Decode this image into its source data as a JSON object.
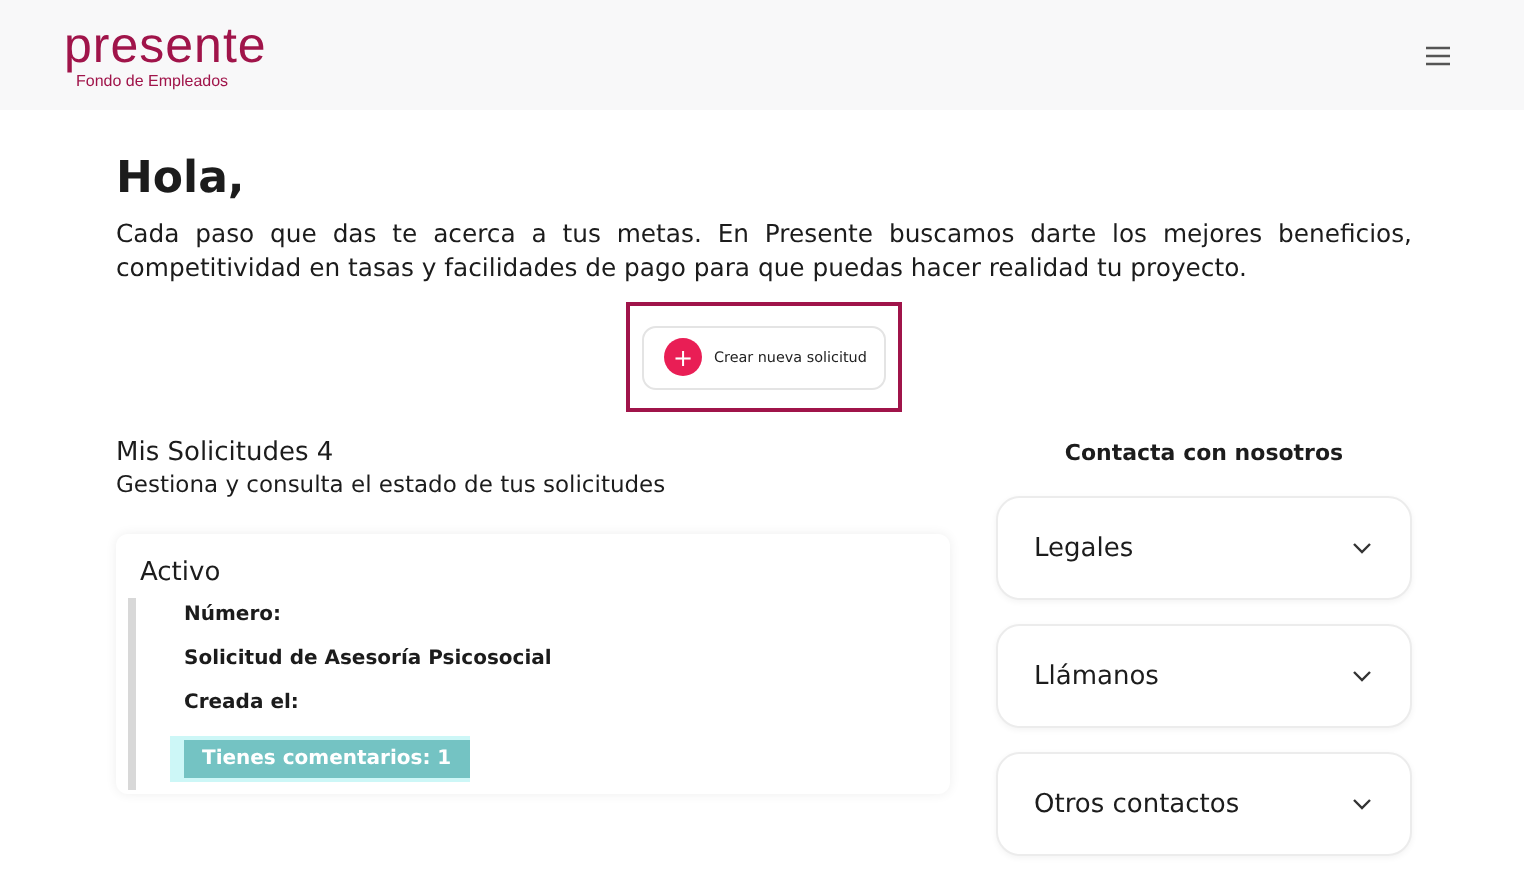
{
  "header": {
    "logo": "presente",
    "logo_subtitle": "Fondo de Empleados"
  },
  "greeting": "Hola,",
  "intro": "Cada paso que das te acerca a tus metas. En Presente buscamos darte los mejores beneficios, competitividad en tasas y facilidades de pago para que puedas hacer realidad tu proyecto.",
  "new_request_button": {
    "icon": "+",
    "label": "Crear nueva solicitud"
  },
  "requests": {
    "title": "Mis Solicitudes 4",
    "subtitle": "Gestiona y consulta el estado de tus solicitudes",
    "cards": [
      {
        "status": "Activo",
        "fields": [
          "Número:",
          "Solicitud de Asesoría Psicosocial",
          "Creada el:"
        ],
        "comments": "Tienes comentarios: 1"
      }
    ]
  },
  "contact": {
    "title": "Contacta con nosotros",
    "items": [
      {
        "label": "Legales",
        "expanded": false
      },
      {
        "label": "Llámanos",
        "expanded": false
      },
      {
        "label": "Otros contactos",
        "expanded": false
      }
    ]
  }
}
